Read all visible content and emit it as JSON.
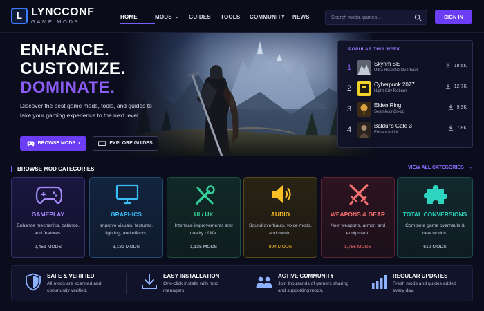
{
  "brand": {
    "mark": "L",
    "name": "LYNCCONF",
    "tagline": "GAME MODS"
  },
  "nav": {
    "items": [
      {
        "label": "HOME",
        "active": true
      },
      {
        "label": "MODS",
        "dropdown": true
      },
      {
        "label": "GUIDES"
      },
      {
        "label": "TOOLS"
      },
      {
        "label": "COMMUNITY"
      },
      {
        "label": "NEWS"
      }
    ],
    "search_placeholder": "Search mods, games...",
    "signin_label": "SIGN IN"
  },
  "hero": {
    "title_line1": "ENHANCE.",
    "title_line2": "CUSTOMIZE.",
    "title_line3": "DOMINATE.",
    "description": "Discover the best game mods, tools, and guides to take your gaming experience to the next level.",
    "primary_button": "BROWSE MODS",
    "primary_arrow": "›",
    "secondary_button": "EXPLORE GUIDES"
  },
  "popular": {
    "heading": "POPULAR THIS WEEK",
    "items": [
      {
        "rank": "1",
        "name": "Skyrim SE",
        "mod": "Ultra Realistic Overhaul",
        "downloads": "18.5K"
      },
      {
        "rank": "2",
        "name": "Cyberpunk 2077",
        "mod": "Night City Reborn",
        "downloads": "12.7K"
      },
      {
        "rank": "3",
        "name": "Elden Ring",
        "mod": "Seamless Co-op",
        "downloads": "9.3K"
      },
      {
        "rank": "4",
        "name": "Baldur's Gate 3",
        "mod": "Enhanced UI",
        "downloads": "7.8K"
      }
    ]
  },
  "categories": {
    "heading": "BROWSE MOD CATEGORIES",
    "view_all": "VIEW ALL CATEGORIES",
    "view_all_arrow": "→",
    "items": [
      {
        "title": "GAMEPLAY",
        "description": "Enhance mechanics, balance, and features.",
        "count": "2,451 MODS",
        "icon": "gamepad-icon",
        "color": "#a78bfa"
      },
      {
        "title": "GRAPHICS",
        "description": "Improve visuals, textures, lighting, and effects.",
        "count": "3,182 MODS",
        "icon": "monitor-icon",
        "color": "#38bdf8"
      },
      {
        "title": "UI / UX",
        "description": "Interface improvements and quality of life.",
        "count": "1,125 MODS",
        "icon": "tools-icon",
        "color": "#34d399"
      },
      {
        "title": "AUDIO",
        "description": "Sound overhauls, voice mods, and music.",
        "count": "894 MODS",
        "icon": "speaker-icon",
        "color": "#fbbf24"
      },
      {
        "title": "WEAPONS & GEAR",
        "description": "New weapons, armor, and equipment.",
        "count": "1,756 MODS",
        "icon": "crossed-swords-icon",
        "color": "#f87171"
      },
      {
        "title": "TOTAL CONVERSIONS",
        "description": "Complete game overhauls & new worlds.",
        "count": "612 MODS",
        "icon": "puzzle-icon",
        "color": "#2dd4bf"
      }
    ]
  },
  "features": [
    {
      "title": "SAFE & VERIFIED",
      "description": "All mods are scanned and community verified.",
      "icon": "shield-icon"
    },
    {
      "title": "EASY INSTALLATION",
      "description": "One-click installs with mod managers.",
      "icon": "download-icon"
    },
    {
      "title": "ACTIVE COMMUNITY",
      "description": "Join thousands of gamers sharing and supporting mods.",
      "icon": "users-icon"
    },
    {
      "title": "REGULAR UPDATES",
      "description": "Fresh mods and guides added every day.",
      "icon": "bar-chart-icon"
    }
  ]
}
